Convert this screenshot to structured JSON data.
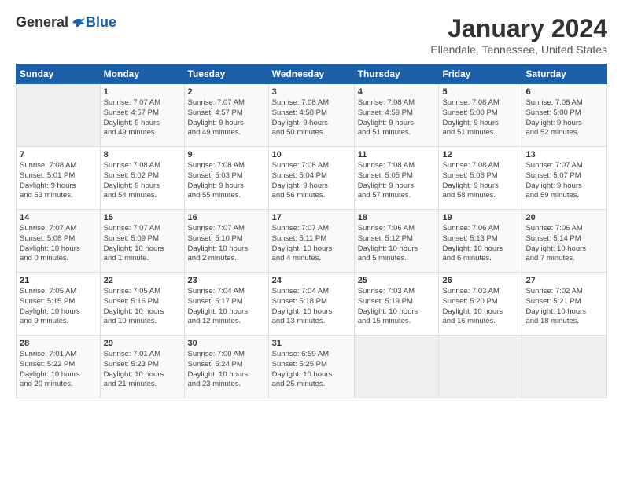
{
  "logo": {
    "general": "General",
    "blue": "Blue"
  },
  "title": "January 2024",
  "location": "Ellendale, Tennessee, United States",
  "headers": [
    "Sunday",
    "Monday",
    "Tuesday",
    "Wednesday",
    "Thursday",
    "Friday",
    "Saturday"
  ],
  "weeks": [
    [
      {
        "day": "",
        "info": ""
      },
      {
        "day": "1",
        "info": "Sunrise: 7:07 AM\nSunset: 4:57 PM\nDaylight: 9 hours\nand 49 minutes."
      },
      {
        "day": "2",
        "info": "Sunrise: 7:07 AM\nSunset: 4:57 PM\nDaylight: 9 hours\nand 49 minutes."
      },
      {
        "day": "3",
        "info": "Sunrise: 7:08 AM\nSunset: 4:58 PM\nDaylight: 9 hours\nand 50 minutes."
      },
      {
        "day": "4",
        "info": "Sunrise: 7:08 AM\nSunset: 4:59 PM\nDaylight: 9 hours\nand 51 minutes."
      },
      {
        "day": "5",
        "info": "Sunrise: 7:08 AM\nSunset: 5:00 PM\nDaylight: 9 hours\nand 51 minutes."
      },
      {
        "day": "6",
        "info": "Sunrise: 7:08 AM\nSunset: 5:00 PM\nDaylight: 9 hours\nand 52 minutes."
      }
    ],
    [
      {
        "day": "7",
        "info": "Sunrise: 7:08 AM\nSunset: 5:01 PM\nDaylight: 9 hours\nand 53 minutes."
      },
      {
        "day": "8",
        "info": "Sunrise: 7:08 AM\nSunset: 5:02 PM\nDaylight: 9 hours\nand 54 minutes."
      },
      {
        "day": "9",
        "info": "Sunrise: 7:08 AM\nSunset: 5:03 PM\nDaylight: 9 hours\nand 55 minutes."
      },
      {
        "day": "10",
        "info": "Sunrise: 7:08 AM\nSunset: 5:04 PM\nDaylight: 9 hours\nand 56 minutes."
      },
      {
        "day": "11",
        "info": "Sunrise: 7:08 AM\nSunset: 5:05 PM\nDaylight: 9 hours\nand 57 minutes."
      },
      {
        "day": "12",
        "info": "Sunrise: 7:08 AM\nSunset: 5:06 PM\nDaylight: 9 hours\nand 58 minutes."
      },
      {
        "day": "13",
        "info": "Sunrise: 7:07 AM\nSunset: 5:07 PM\nDaylight: 9 hours\nand 59 minutes."
      }
    ],
    [
      {
        "day": "14",
        "info": "Sunrise: 7:07 AM\nSunset: 5:08 PM\nDaylight: 10 hours\nand 0 minutes."
      },
      {
        "day": "15",
        "info": "Sunrise: 7:07 AM\nSunset: 5:09 PM\nDaylight: 10 hours\nand 1 minute."
      },
      {
        "day": "16",
        "info": "Sunrise: 7:07 AM\nSunset: 5:10 PM\nDaylight: 10 hours\nand 2 minutes."
      },
      {
        "day": "17",
        "info": "Sunrise: 7:07 AM\nSunset: 5:11 PM\nDaylight: 10 hours\nand 4 minutes."
      },
      {
        "day": "18",
        "info": "Sunrise: 7:06 AM\nSunset: 5:12 PM\nDaylight: 10 hours\nand 5 minutes."
      },
      {
        "day": "19",
        "info": "Sunrise: 7:06 AM\nSunset: 5:13 PM\nDaylight: 10 hours\nand 6 minutes."
      },
      {
        "day": "20",
        "info": "Sunrise: 7:06 AM\nSunset: 5:14 PM\nDaylight: 10 hours\nand 7 minutes."
      }
    ],
    [
      {
        "day": "21",
        "info": "Sunrise: 7:05 AM\nSunset: 5:15 PM\nDaylight: 10 hours\nand 9 minutes."
      },
      {
        "day": "22",
        "info": "Sunrise: 7:05 AM\nSunset: 5:16 PM\nDaylight: 10 hours\nand 10 minutes."
      },
      {
        "day": "23",
        "info": "Sunrise: 7:04 AM\nSunset: 5:17 PM\nDaylight: 10 hours\nand 12 minutes."
      },
      {
        "day": "24",
        "info": "Sunrise: 7:04 AM\nSunset: 5:18 PM\nDaylight: 10 hours\nand 13 minutes."
      },
      {
        "day": "25",
        "info": "Sunrise: 7:03 AM\nSunset: 5:19 PM\nDaylight: 10 hours\nand 15 minutes."
      },
      {
        "day": "26",
        "info": "Sunrise: 7:03 AM\nSunset: 5:20 PM\nDaylight: 10 hours\nand 16 minutes."
      },
      {
        "day": "27",
        "info": "Sunrise: 7:02 AM\nSunset: 5:21 PM\nDaylight: 10 hours\nand 18 minutes."
      }
    ],
    [
      {
        "day": "28",
        "info": "Sunrise: 7:01 AM\nSunset: 5:22 PM\nDaylight: 10 hours\nand 20 minutes."
      },
      {
        "day": "29",
        "info": "Sunrise: 7:01 AM\nSunset: 5:23 PM\nDaylight: 10 hours\nand 21 minutes."
      },
      {
        "day": "30",
        "info": "Sunrise: 7:00 AM\nSunset: 5:24 PM\nDaylight: 10 hours\nand 23 minutes."
      },
      {
        "day": "31",
        "info": "Sunrise: 6:59 AM\nSunset: 5:25 PM\nDaylight: 10 hours\nand 25 minutes."
      },
      {
        "day": "",
        "info": ""
      },
      {
        "day": "",
        "info": ""
      },
      {
        "day": "",
        "info": ""
      }
    ]
  ]
}
